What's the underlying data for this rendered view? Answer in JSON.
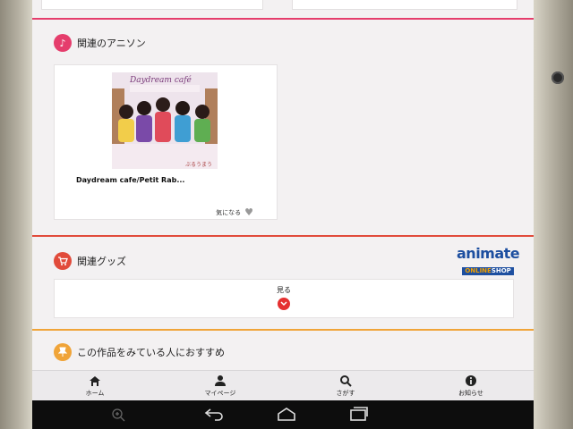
{
  "sections": {
    "anison": {
      "title": "関連のアニソン",
      "items": [
        {
          "title": "Daydream cafe/Petit Rab...",
          "album_logo": "Daydream café",
          "album_sub": "ぶるうまうんてん",
          "fav_label": "気になる"
        }
      ]
    },
    "goods": {
      "title": "関連グッズ",
      "logo_brand": "animate",
      "logo_sub_left": "ONLINE",
      "logo_sub_right": "SHOP",
      "see_label": "見る"
    },
    "recommend": {
      "title": "この作品をみている人におすすめ"
    }
  },
  "tabbar": {
    "items": [
      {
        "label": "ホーム",
        "icon": "home-icon"
      },
      {
        "label": "マイページ",
        "icon": "person-icon"
      },
      {
        "label": "さがす",
        "icon": "search-icon"
      },
      {
        "label": "お知らせ",
        "icon": "info-icon"
      }
    ]
  },
  "colors": {
    "pink": "#e53d6c",
    "red": "#e14b3b",
    "orange": "#f0a438",
    "brand_blue": "#1d4fa0"
  }
}
